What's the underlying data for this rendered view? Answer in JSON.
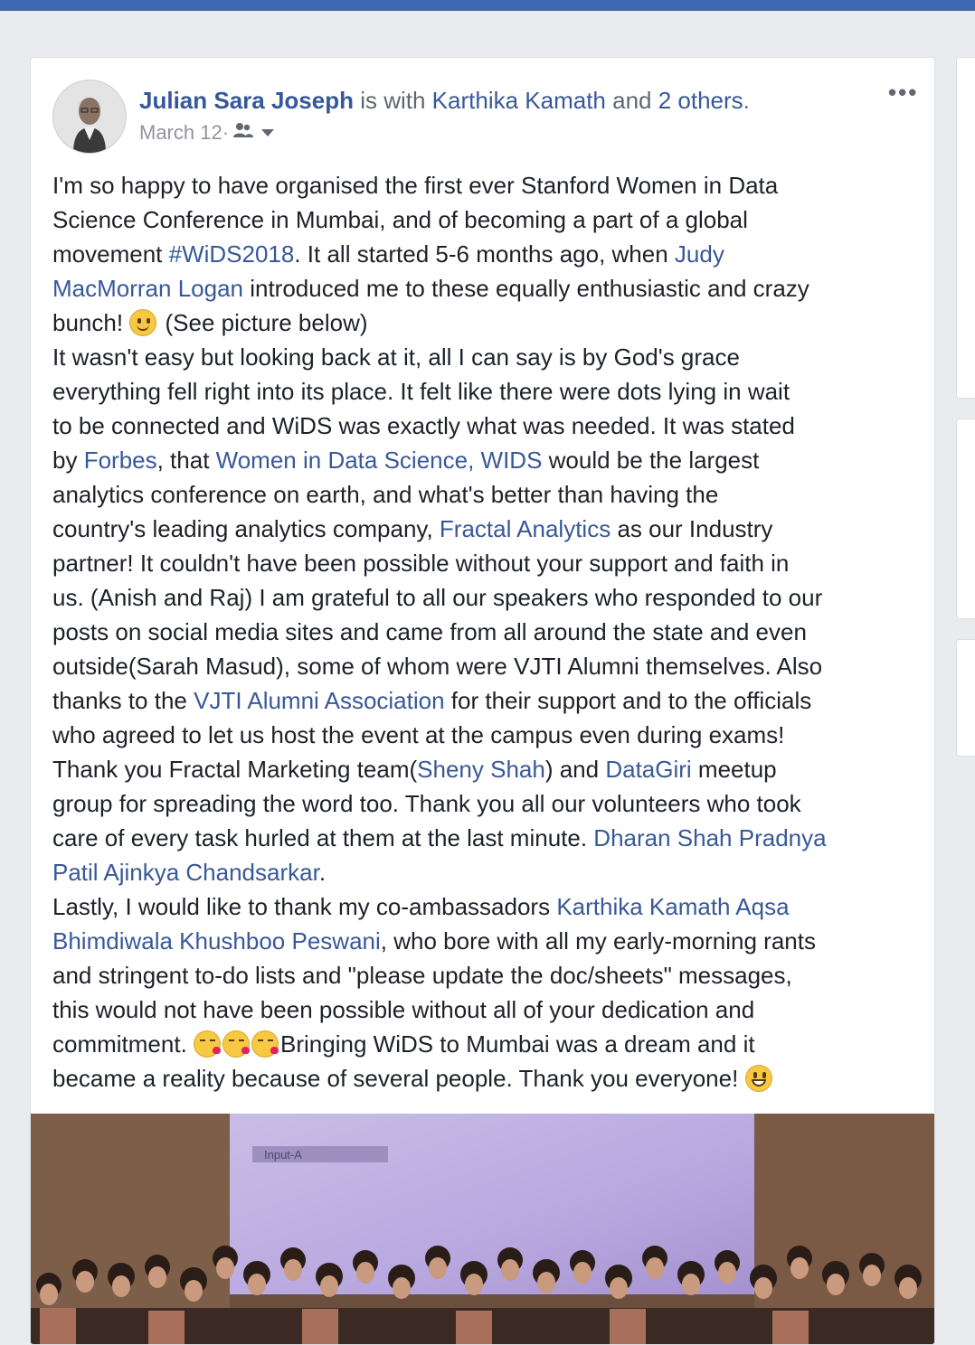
{
  "post": {
    "author": "Julian Sara Joseph",
    "with_text": " is with ",
    "tagged": "Karthika Kamath",
    "and_text": " and ",
    "others": "2 others",
    "period": ".",
    "date": "March 12",
    "dot": " · ",
    "more": "•••"
  },
  "body": {
    "l1": "I'm so happy to have organised the first ever Stanford Women in Data",
    "l2": "Science Conference in Mumbai, and of becoming a part of a global",
    "l3a": "movement ",
    "hashtag": "#WiDS2018",
    "l3b": ". It all started 5-6 months ago, when ",
    "judy_a": "Judy",
    "judy_b": "MacMorran Logan",
    "l4b": " introduced me to these equally enthusiastic and crazy",
    "l5a": "bunch! ",
    "l5b": " (See picture below)",
    "l6": "It wasn't easy but looking back at it, all I can say is by God's grace",
    "l7": "everything fell right into its place. It felt like there were dots lying in wait",
    "l8": "to be connected and WiDS was exactly what was needed. It was stated",
    "l9a": "by ",
    "forbes": "Forbes",
    "l9b": ", that ",
    "wids_link": "Women in Data Science, WIDS",
    "l9c": " would be the largest",
    "l10": "analytics conference on earth, and what's better than having the",
    "l11a": "country's leading analytics company, ",
    "fractal": "Fractal Analytics",
    "l11b": " as our Industry",
    "l12": "partner! It couldn't have been possible without your support and faith in",
    "l13": "us. (Anish and Raj) I am grateful to all our speakers who responded to our",
    "l14": "posts on social media sites and came from all around the state and even",
    "l15": "outside(Sarah Masud), some of whom were VJTI Alumni themselves. Also",
    "l16a": "thanks to the ",
    "vjti": "VJTI Alumni Association",
    "l16b": " for their support and to the officials",
    "l17": "who agreed to let us host the event at the campus even during exams!",
    "l18a": "Thank you Fractal Marketing team(",
    "sheny": "Sheny Shah",
    "l18b": ") and ",
    "datagiri": "DataGiri",
    "l18c": " meetup",
    "l19": "group for spreading the word too. Thank you all our volunteers who took",
    "l20a": "care of every task hurled at them at the last minute. ",
    "vol_a": "Dharan Shah Pradnya",
    "vol_b": "Patil Ajinkya Chandsarkar",
    "l21b": ".",
    "l22a": "Lastly, I would like to thank my co-ambassadors ",
    "amb_a": "Karthika Kamath Aqsa",
    "amb_b": "Bhimdiwala Khushboo Peswani",
    "l23b": ", who bore with all my early-morning rants",
    "l24": "and stringent to-do lists and \"please update the doc/sheets\" messages,",
    "l25": "this would not have been possible without all of your dedication and",
    "l26a": "commitment. ",
    "l26b": "Bringing WiDS to Mumbai was a dream and it",
    "l27": "became a reality because of several people. Thank you everyone! "
  },
  "photo": {
    "projector_label": "Input-A"
  },
  "colors": {
    "link": "#385898",
    "author": "#365899",
    "text": "#1d2129",
    "meta": "#90949c",
    "topbar": "#4267b2"
  },
  "icons": {
    "audience": "friends-icon",
    "dropdown": "chevron-down-icon",
    "options": "more-options-icon"
  }
}
